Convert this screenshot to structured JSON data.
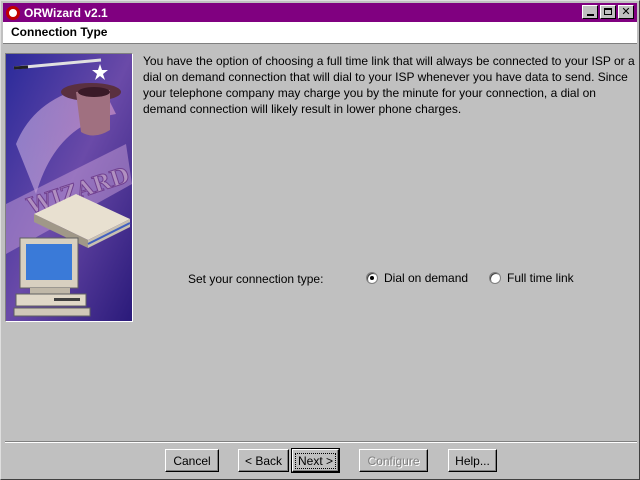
{
  "window": {
    "title": "ORWizard v2.1",
    "title_bar_color": "#800080"
  },
  "header": {
    "page_title": "Connection Type"
  },
  "side_image": {
    "banner_text": "WIZARD"
  },
  "main": {
    "description": "You have the option of choosing a full time link that will always be connected to your ISP or a dial on demand connection that will dial to your ISP whenever you have data to send. Since your telephone company may charge you by the minute for your connection, a dial on demand connection will likely result in lower phone charges.",
    "connection_label": "Set your connection type:",
    "options": [
      {
        "label": "Dial on demand",
        "selected": true
      },
      {
        "label": "Full time link",
        "selected": false
      }
    ]
  },
  "buttons": {
    "cancel": "Cancel",
    "back": "< Back",
    "next": "Next >",
    "configure": "Configure",
    "help": "Help..."
  }
}
